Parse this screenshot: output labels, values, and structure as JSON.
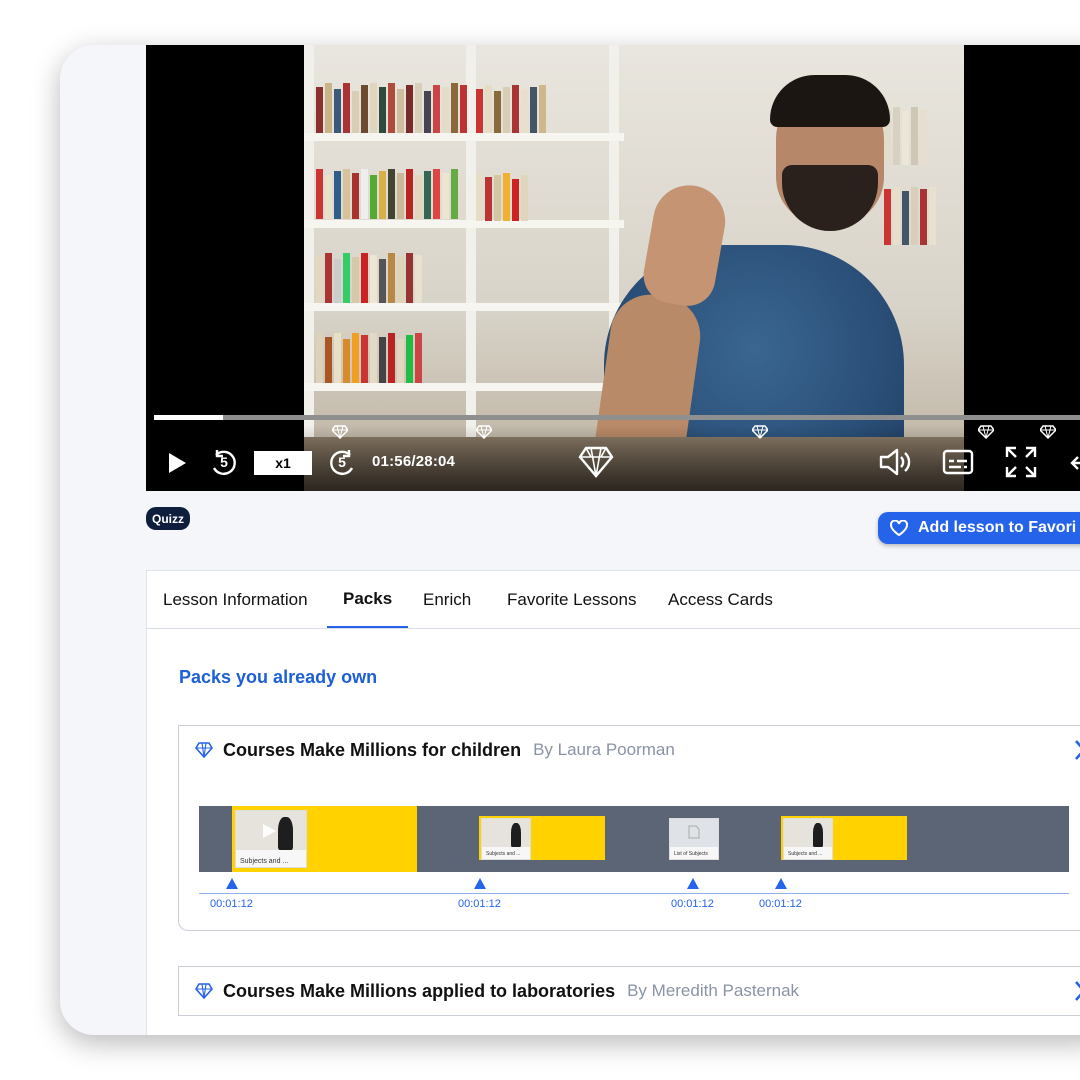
{
  "player": {
    "speed_label": "x1",
    "current_time": "01:56",
    "duration": "28:04",
    "time_display": "01:56/28:04",
    "progress": 0.07,
    "skip_back_seconds": "5",
    "skip_forward_seconds": "5"
  },
  "badges": {
    "quiz": "Quizz"
  },
  "actions": {
    "add_favorite": "Add lesson to Favori"
  },
  "tabs": [
    {
      "label": "Lesson Information",
      "active": false
    },
    {
      "label": "Packs",
      "active": true
    },
    {
      "label": "Enrich",
      "active": false
    },
    {
      "label": "Favorite Lessons",
      "active": false
    },
    {
      "label": "Access Cards",
      "active": false
    }
  ],
  "packs": {
    "heading": "Packs you already own",
    "items": [
      {
        "title": "Courses Make Millions for children",
        "author": "By Laura Poorman",
        "expanded": true
      },
      {
        "title": "Courses Make Millions applied to laboratories",
        "author": "By Meredith Pasternak",
        "expanded": false
      }
    ],
    "timeline": [
      {
        "caption": "Subjects and ...",
        "time": "00:01:12"
      },
      {
        "caption": "Subjects and ...",
        "time": "00:01:12"
      },
      {
        "caption": "List of Subjects",
        "time": "00:01:12"
      },
      {
        "caption": "Subjects and ...",
        "time": "00:01:12"
      }
    ]
  },
  "colors": {
    "accent": "#2563eb",
    "highlight": "#ffd200",
    "timeline_bg": "#5c6575",
    "badge_bg": "#0f1e3d"
  }
}
